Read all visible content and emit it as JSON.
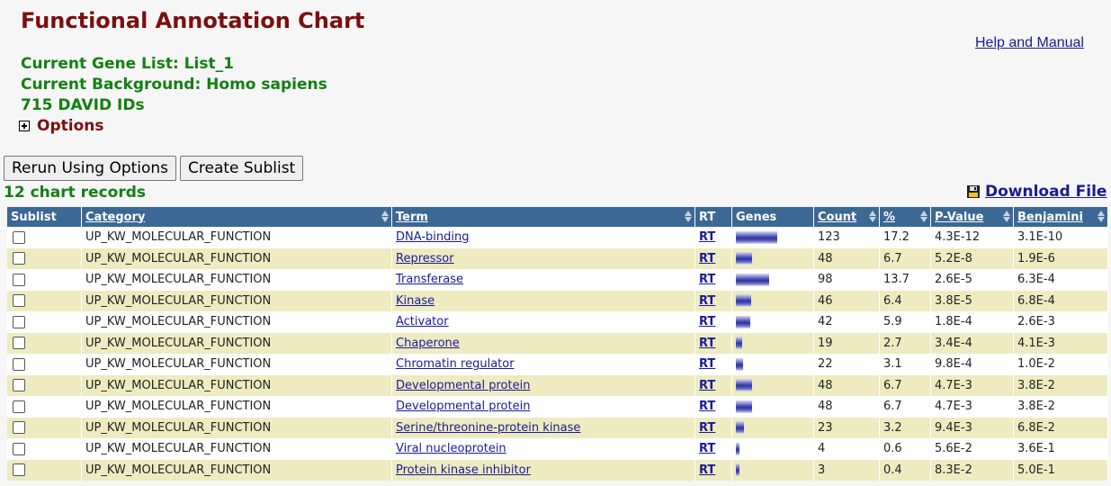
{
  "page": {
    "title": "Functional Annotation Chart",
    "help_link": "Help and Manual",
    "gene_list": "Current Gene List: List_1",
    "background": "Current Background: Homo sapiens",
    "ids": "715 DAVID IDs",
    "options_label": "Options"
  },
  "buttons": {
    "rerun": "Rerun Using Options",
    "sublist": "Create Sublist"
  },
  "records_label": "12 chart records",
  "download_label": "Download File",
  "table": {
    "headers": [
      "Sublist",
      "Category",
      "Term",
      "RT",
      "Genes",
      "Count",
      "%",
      "P-Value",
      "Benjamini"
    ],
    "rows": [
      {
        "category": "UP_KW_MOLECULAR_FUNCTION",
        "term": "DNA-binding",
        "rt": "RT",
        "count": "123",
        "percent": "17.2",
        "pvalue": "4.3E-12",
        "benjamini": "3.1E-10"
      },
      {
        "category": "UP_KW_MOLECULAR_FUNCTION",
        "term": "Repressor",
        "rt": "RT",
        "count": "48",
        "percent": "6.7",
        "pvalue": "5.2E-8",
        "benjamini": "1.9E-6"
      },
      {
        "category": "UP_KW_MOLECULAR_FUNCTION",
        "term": "Transferase",
        "rt": "RT",
        "count": "98",
        "percent": "13.7",
        "pvalue": "2.6E-5",
        "benjamini": "6.3E-4"
      },
      {
        "category": "UP_KW_MOLECULAR_FUNCTION",
        "term": "Kinase",
        "rt": "RT",
        "count": "46",
        "percent": "6.4",
        "pvalue": "3.8E-5",
        "benjamini": "6.8E-4"
      },
      {
        "category": "UP_KW_MOLECULAR_FUNCTION",
        "term": "Activator",
        "rt": "RT",
        "count": "42",
        "percent": "5.9",
        "pvalue": "1.8E-4",
        "benjamini": "2.6E-3"
      },
      {
        "category": "UP_KW_MOLECULAR_FUNCTION",
        "term": "Chaperone",
        "rt": "RT",
        "count": "19",
        "percent": "2.7",
        "pvalue": "3.4E-4",
        "benjamini": "4.1E-3"
      },
      {
        "category": "UP_KW_MOLECULAR_FUNCTION",
        "term": "Chromatin regulator",
        "rt": "RT",
        "count": "22",
        "percent": "3.1",
        "pvalue": "9.8E-4",
        "benjamini": "1.0E-2"
      },
      {
        "category": "UP_KW_MOLECULAR_FUNCTION",
        "term": "Developmental protein",
        "rt": "RT",
        "count": "48",
        "percent": "6.7",
        "pvalue": "4.7E-3",
        "benjamini": "3.8E-2"
      },
      {
        "category": "UP_KW_MOLECULAR_FUNCTION",
        "term": "Developmental protein",
        "rt": "RT",
        "count": "48",
        "percent": "6.7",
        "pvalue": "4.7E-3",
        "benjamini": "3.8E-2"
      },
      {
        "category": "UP_KW_MOLECULAR_FUNCTION",
        "term": "Serine/threonine-protein kinase",
        "rt": "RT",
        "count": "23",
        "percent": "3.2",
        "pvalue": "9.4E-3",
        "benjamini": "6.8E-2"
      },
      {
        "category": "UP_KW_MOLECULAR_FUNCTION",
        "term": "Viral nucleoprotein",
        "rt": "RT",
        "count": "4",
        "percent": "0.6",
        "pvalue": "5.6E-2",
        "benjamini": "3.6E-1"
      },
      {
        "category": "UP_KW_MOLECULAR_FUNCTION",
        "term": "Protein kinase inhibitor",
        "rt": "RT",
        "count": "3",
        "percent": "0.4",
        "pvalue": "8.3E-2",
        "benjamini": "5.0E-1"
      }
    ]
  },
  "colors": {
    "title": "#7a0f0f",
    "info": "#128012",
    "header_bg": "#3b6894",
    "row_alt": "#eeebc0",
    "link": "#1a1a9a"
  }
}
